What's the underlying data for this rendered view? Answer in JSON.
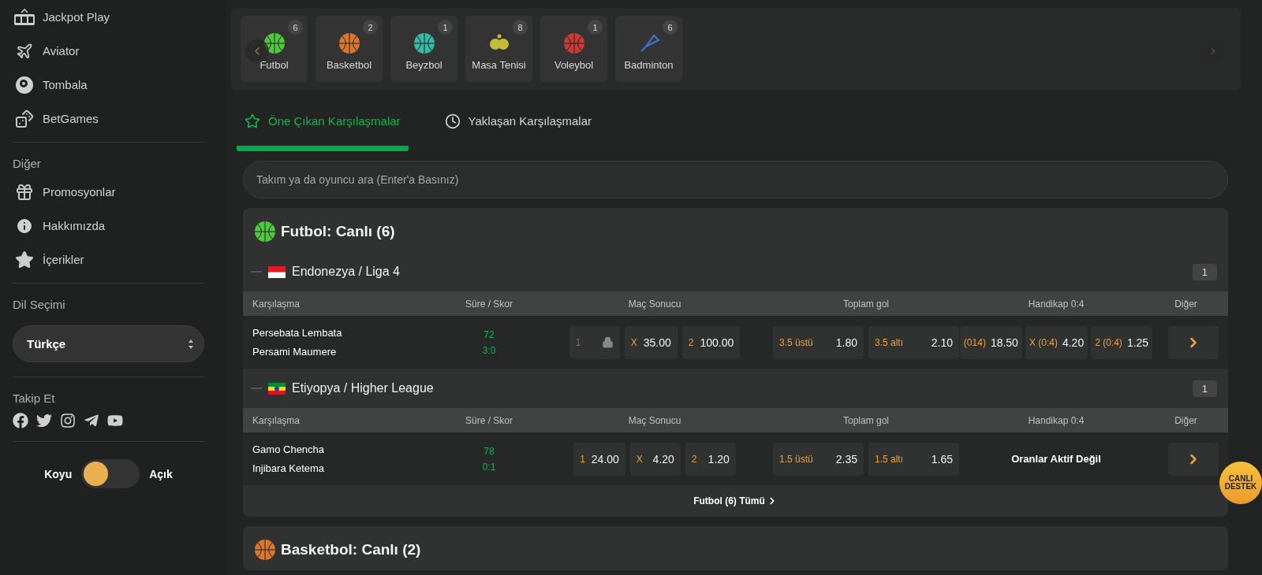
{
  "sidebar": {
    "games": [
      {
        "label": "Jackpot Play"
      },
      {
        "label": "Aviator"
      },
      {
        "label": "Tombala"
      },
      {
        "label": "BetGames"
      }
    ],
    "other": {
      "title": "Diğer",
      "items": [
        {
          "label": "Promosyonlar"
        },
        {
          "label": "Hakkımızda"
        },
        {
          "label": "İçerikler"
        }
      ]
    },
    "language": {
      "title": "Dil Seçimi",
      "value": "Türkçe"
    },
    "follow": {
      "title": "Takip Et"
    },
    "theme": {
      "dark_label": "Koyu",
      "light_label": "Açık",
      "light": false
    }
  },
  "sports": [
    {
      "name": "Futbol",
      "count": "6"
    },
    {
      "name": "Basketbol",
      "count": "2"
    },
    {
      "name": "Beyzbol",
      "count": "1"
    },
    {
      "name": "Masa Tenisi",
      "count": "8"
    },
    {
      "name": "Voleybol",
      "count": "1"
    },
    {
      "name": "Badminton",
      "count": "6"
    }
  ],
  "tabs": [
    {
      "label": "Öne Çıkan Karşılaşmalar",
      "selected": true
    },
    {
      "label": "Yaklaşan Karşılaşmalar",
      "selected": false
    }
  ],
  "search": {
    "placeholder": "Takım ya da oyuncu ara (Enter'a Basınız)"
  },
  "sections": [
    {
      "title": "Futbol: Canlı (6)",
      "leagues": [
        {
          "name": "Endonezya / Liga 4",
          "count": "1",
          "columns": [
            "Karşılaşma",
            "Süre / Skor",
            "Maç Sonucu",
            "Toplam gol",
            "Handikap 0:4",
            "Diğer"
          ],
          "matches": [
            {
              "home": "Persebata Lembata",
              "away": "Persami Maumere",
              "minute": "72",
              "score": "3:0",
              "result": [
                {
                  "label": "1",
                  "locked": true
                },
                {
                  "label": "X",
                  "odd": "35.00",
                  "locked": false
                },
                {
                  "label": "2",
                  "odd": "100.00",
                  "locked": false
                }
              ],
              "totals": [
                {
                  "label": "3.5 üstü",
                  "odd": "1.80"
                },
                {
                  "label": "3.5 altı",
                  "odd": "2.10"
                }
              ],
              "handicap": [
                {
                  "label": "(014)",
                  "odd": "18.50"
                },
                {
                  "label": "X (0:4)",
                  "odd": "4.20"
                },
                {
                  "label": "2 (0:4)",
                  "odd": "1.25"
                }
              ]
            }
          ]
        },
        {
          "name": "Etiyopya / Higher League",
          "count": "1",
          "columns": [
            "Karşılaşma",
            "Süre / Skor",
            "Maç Sonucu",
            "Toplam gol",
            "Handikap 0:4",
            "Diğer"
          ],
          "matches": [
            {
              "home": "Gamo Chencha",
              "away": "Injibara Ketema",
              "minute": "78",
              "score": "0:1",
              "result": [
                {
                  "label": "1",
                  "odd": "24.00",
                  "locked": false
                },
                {
                  "label": "X",
                  "odd": "4.20",
                  "locked": false
                },
                {
                  "label": "2",
                  "odd": "1.20",
                  "locked": false
                }
              ],
              "totals": [
                {
                  "label": "1.5 üstü",
                  "odd": "2.35"
                },
                {
                  "label": "1.5 altı",
                  "odd": "1.65"
                }
              ],
              "handicap_note": "Oranlar Aktif Değil"
            }
          ]
        }
      ],
      "footer": "Futbol (6) Tümü"
    },
    {
      "title": "Basketbol: Canlı (2)"
    }
  ],
  "support": {
    "line1": "CANLI",
    "line2": "DESTEK"
  }
}
